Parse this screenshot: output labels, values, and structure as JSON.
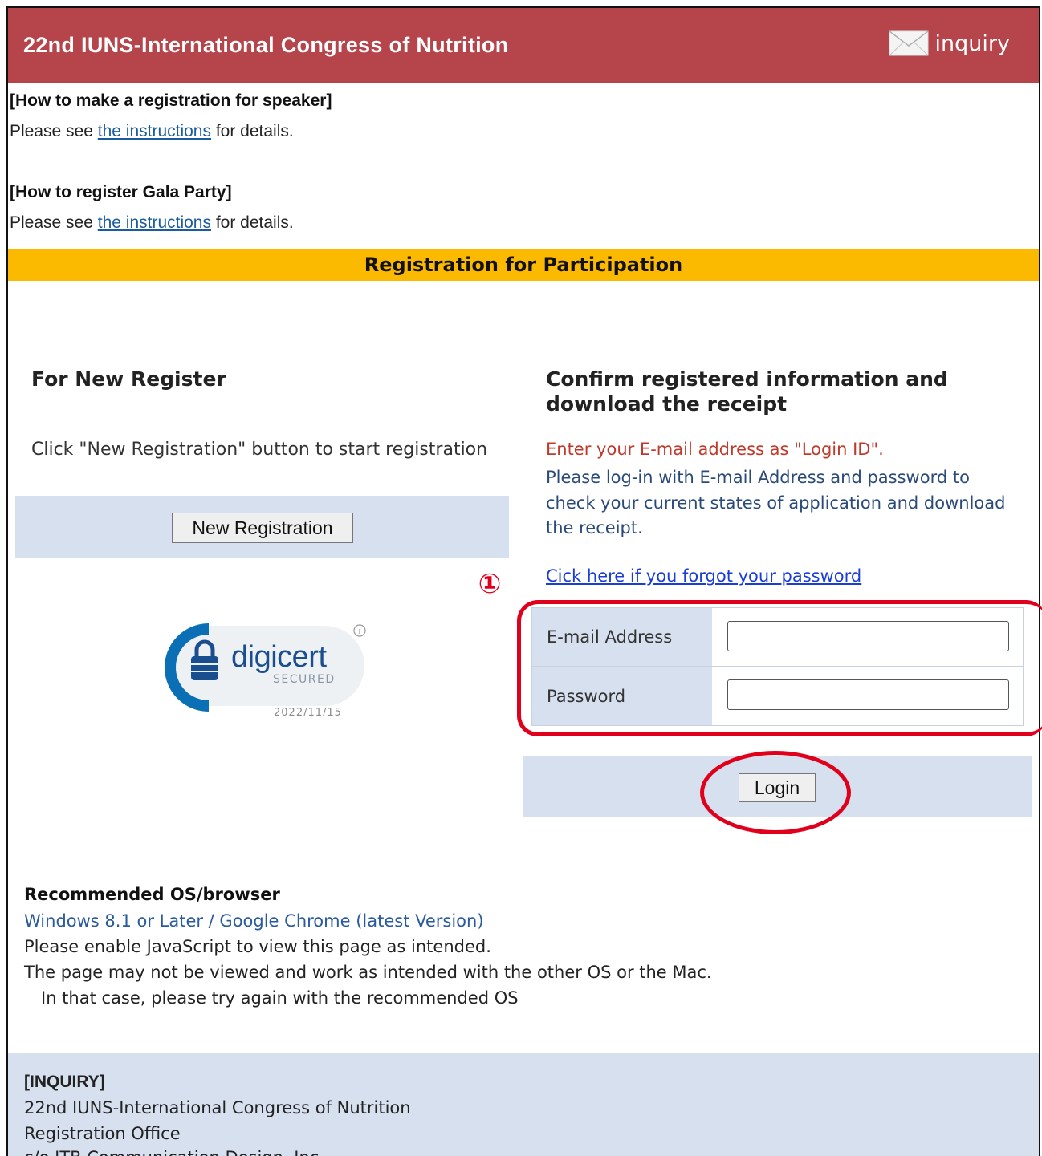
{
  "header": {
    "title": "22nd IUNS-International Congress of Nutrition",
    "inquiry_label": "inquiry"
  },
  "speaker_section": {
    "heading": "[How to make a registration for speaker]",
    "text_before": "Please see ",
    "link": "the instructions",
    "text_after": " for details."
  },
  "gala_section": {
    "heading": "[How to register Gala Party]",
    "text_before": "Please see ",
    "link": "the instructions",
    "text_after": " for details."
  },
  "banner": "Registration for Participation",
  "new_register": {
    "title": "For New Register",
    "description": "Click \"New Registration\" button to start registration",
    "button": "New Registration"
  },
  "seal": {
    "brand": "digicert",
    "sub": "SECURED",
    "date": "2022/11/15"
  },
  "confirm": {
    "title_line1": "Confirm registered information and",
    "title_line2": "download the receipt",
    "red_note": "Enter your E-mail address as \"Login ID\".",
    "info": "Please log-in with E-mail Address and password to check your current states of application and download the receipt.",
    "forgot_link": "Cick here if you forgot your password",
    "marker": "①",
    "email_label": "E-mail Address",
    "email_value": "",
    "password_label": "Password",
    "password_value": "",
    "login_button": "Login"
  },
  "recommended": {
    "title": "Recommended OS/browser",
    "os": "Windows 8.1 or Later / Google Chrome (latest Version)",
    "line1": "Please enable JavaScript to view this page as intended.",
    "line2": "The page may not be viewed and work as intended with the other OS or the Mac.",
    "line3": "In that case, please try again with the recommended OS"
  },
  "footer": {
    "heading": "[INQUIRY]",
    "line1": "22nd IUNS-International Congress of Nutrition",
    "line2": "Registration Office",
    "line3": "c/o JTB Communication Design, Inc."
  },
  "colors": {
    "header_bg": "#b5444b",
    "banner_bg": "#fbb900",
    "panel_bg": "#d6e0ef",
    "annotation_red": "#e0001b"
  }
}
